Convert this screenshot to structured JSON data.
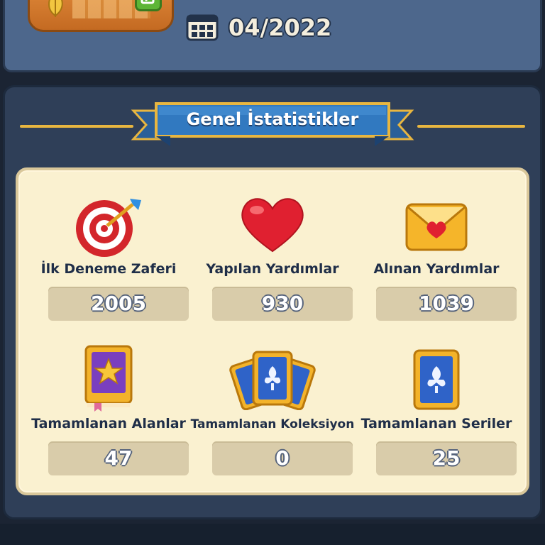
{
  "header": {
    "date": "04/2022",
    "icons": [
      "leaf-icon",
      "edit-icon",
      "calendar-icon"
    ]
  },
  "panel": {
    "title": "Genel İstatistikler"
  },
  "stats": [
    {
      "label": "İlk Deneme Zaferi",
      "value": "2005",
      "icon": "target-icon"
    },
    {
      "label": "Yapılan Yardımlar",
      "value": "930",
      "icon": "heart-icon"
    },
    {
      "label": "Alınan Yardımlar",
      "value": "1039",
      "icon": "envelope-icon"
    },
    {
      "label": "Tamamlanan Alanlar",
      "value": "47",
      "icon": "star-book-icon"
    },
    {
      "label": "Tamamlanan Koleksiyon",
      "value": "0",
      "icon": "card-fan-icon"
    },
    {
      "label": "Tamamlanan Seriler",
      "value": "25",
      "icon": "card-icon"
    }
  ],
  "colors": {
    "panel_bg": "#2f3f58",
    "stats_bg": "#faf1d0",
    "ribbon_blue": "#2e6fb0",
    "ribbon_gold": "#e8b640",
    "label_text": "#1f2e48"
  }
}
